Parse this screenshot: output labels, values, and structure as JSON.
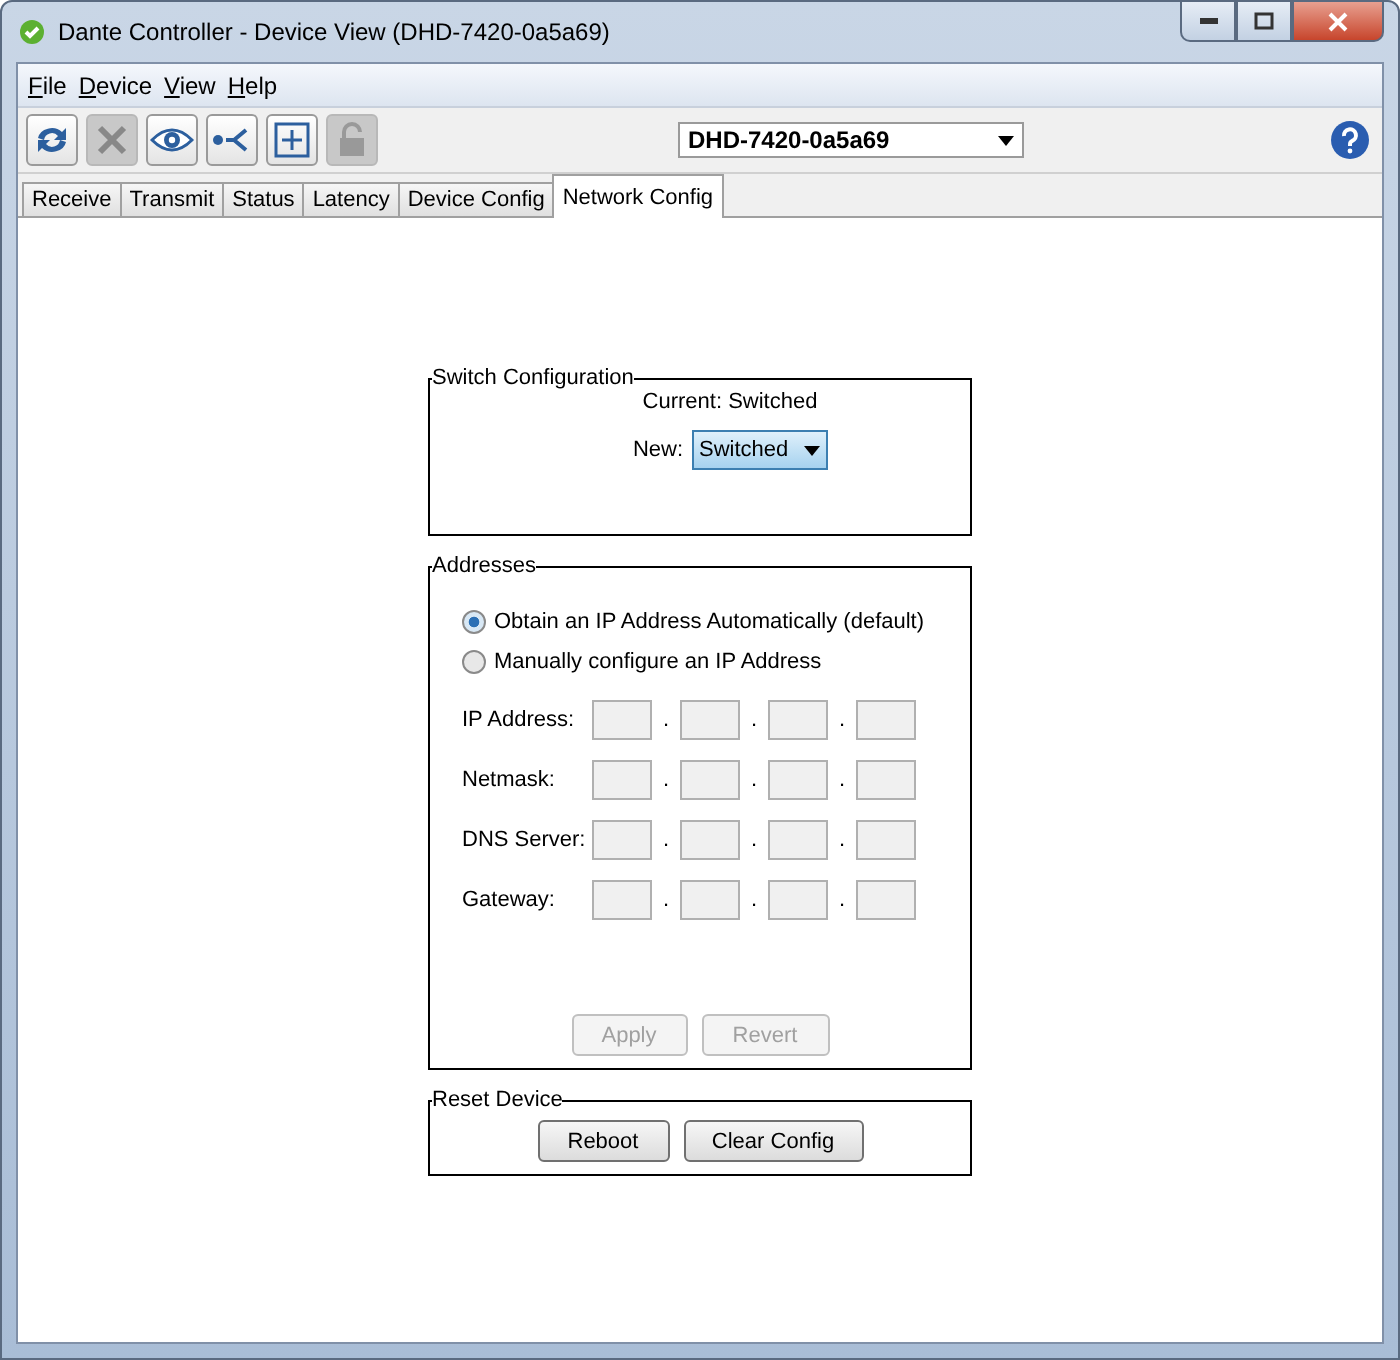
{
  "window": {
    "title": "Dante Controller - Device View (DHD-7420-0a5a69)"
  },
  "menu": [
    {
      "label": "File"
    },
    {
      "label": "Device"
    },
    {
      "label": "View"
    },
    {
      "label": "Help"
    }
  ],
  "toolbar": {
    "buttons": [
      {
        "kind": "refresh",
        "disabled": false
      },
      {
        "kind": "tools",
        "disabled": true
      },
      {
        "kind": "eye",
        "disabled": false
      },
      {
        "kind": "network",
        "disabled": false
      },
      {
        "kind": "plus",
        "disabled": false
      },
      {
        "kind": "lock",
        "disabled": true
      }
    ],
    "device_select": {
      "value": "DHD-7420-0a5a69"
    }
  },
  "tabs": [
    {
      "label": "Receive",
      "selected": false
    },
    {
      "label": "Transmit",
      "selected": false
    },
    {
      "label": "Status",
      "selected": false
    },
    {
      "label": "Latency",
      "selected": false
    },
    {
      "label": "Device Config",
      "selected": false
    },
    {
      "label": "Network Config",
      "selected": true
    }
  ],
  "switch_config": {
    "title": "Switch Configuration",
    "current": "Current: Switched",
    "new_label": "New:",
    "new_value": "Switched"
  },
  "addresses": {
    "title": "Addresses",
    "radios": [
      {
        "label": "Obtain an IP Address Automatically (default)",
        "selected": true
      },
      {
        "label": "Manually configure an IP Address",
        "selected": false
      }
    ],
    "rows": [
      {
        "label": "IP Address:",
        "disabled": true,
        "separators": [
          ".",
          ".",
          "."
        ]
      },
      {
        "label": "Netmask:",
        "disabled": true,
        "separators": [
          ".",
          ".",
          "."
        ]
      },
      {
        "label": "DNS Server:",
        "disabled": true,
        "separators": [
          ".",
          ".",
          "."
        ]
      },
      {
        "label": "Gateway:",
        "disabled": true,
        "separators": [
          ".",
          ".",
          "."
        ]
      }
    ],
    "buttons": [
      {
        "label": "Apply",
        "disabled": true
      },
      {
        "label": "Revert",
        "disabled": true
      }
    ]
  },
  "reset_device": {
    "title": "Reset Device",
    "buttons": [
      {
        "label": "Reboot",
        "disabled": false
      },
      {
        "label": "Clear Config",
        "disabled": false
      }
    ]
  }
}
